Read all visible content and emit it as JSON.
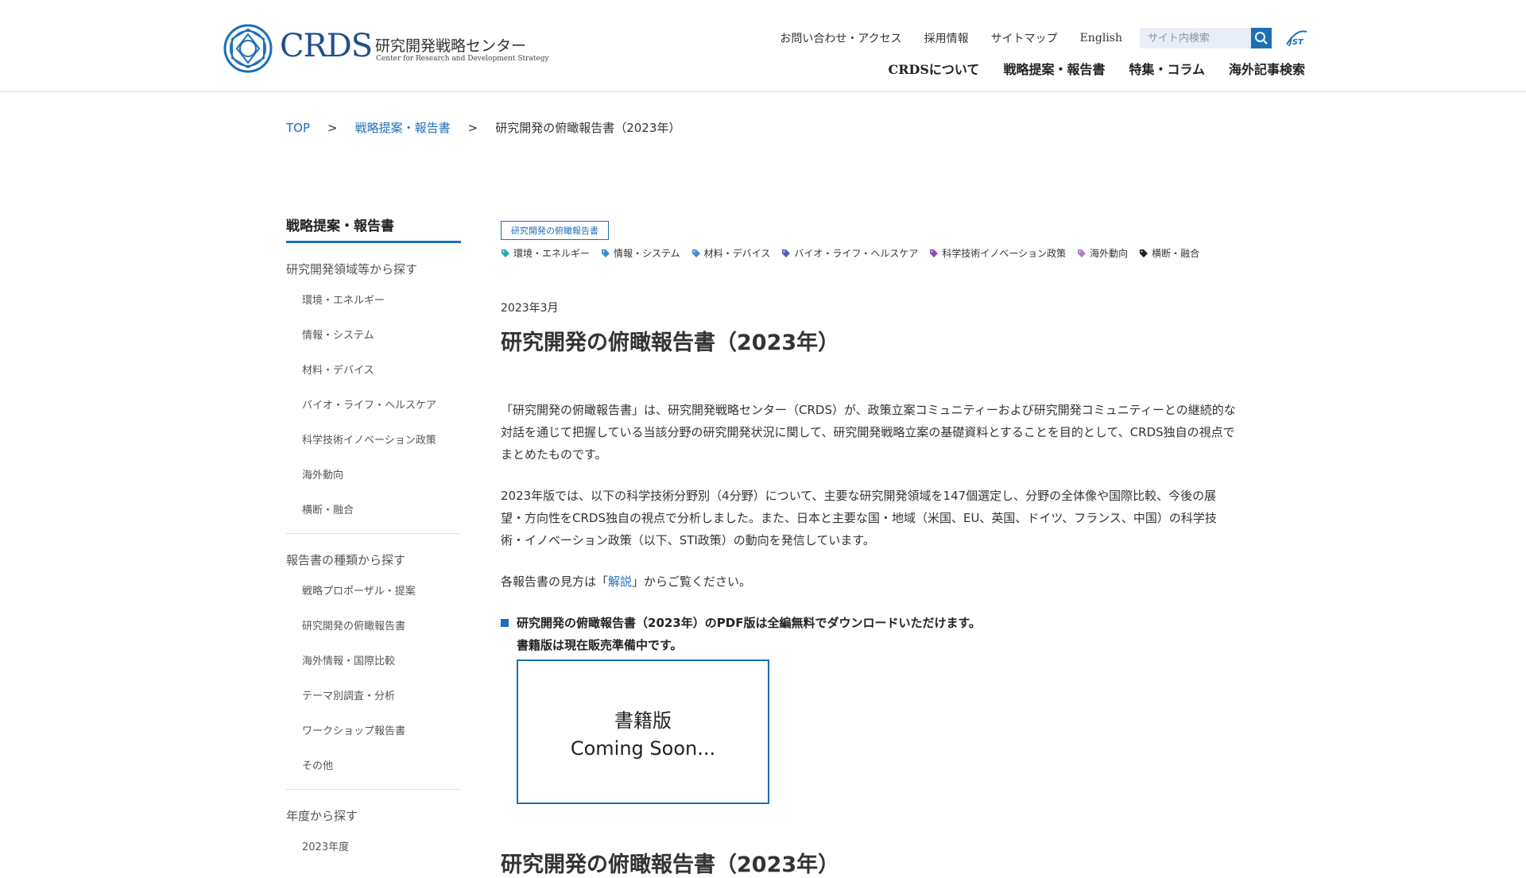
{
  "header": {
    "logo": {
      "text": "CRDS",
      "jp": "研究開発戦略センター",
      "en": "Center for Research and Development Strategy"
    },
    "util_links": [
      "お問い合わせ・アクセス",
      "採用情報",
      "サイトマップ",
      "English"
    ],
    "search": {
      "placeholder": "サイト内検索",
      "button_icon": "search-icon"
    },
    "jst_logo": "JST",
    "main_nav": [
      "CRDSについて",
      "戦略提案・報告書",
      "特集・コラム",
      "海外記事検索"
    ]
  },
  "breadcrumb": {
    "items": [
      "TOP",
      "戦略提案・報告書"
    ],
    "separator": ">",
    "current": "研究開発の俯瞰報告書（2023年）"
  },
  "sidebar": {
    "title": "戦略提案・報告書",
    "sections": [
      {
        "heading": "研究開発領域等から探す",
        "items": [
          "環境・エネルギー",
          "情報・システム",
          "材料・デバイス",
          "バイオ・ライフ・ヘルスケア",
          "科学技術イノベーション政策",
          "海外動向",
          "横断・融合"
        ]
      },
      {
        "heading": "報告書の種類から探す",
        "items": [
          "戦略プロポーザル・提案",
          "研究開発の俯瞰報告書",
          "海外情報・国際比較",
          "テーマ別調査・分析",
          "ワークショップ報告書",
          "その他"
        ]
      },
      {
        "heading": "年度から探す",
        "items": [
          "2023年度"
        ]
      }
    ]
  },
  "main": {
    "category_badge": "研究開発の俯瞰報告書",
    "tags": [
      {
        "label": "環境・エネルギー",
        "color": "#2aa7b8"
      },
      {
        "label": "情報・システム",
        "color": "#3a8fd0"
      },
      {
        "label": "材料・デバイス",
        "color": "#4a8bd6"
      },
      {
        "label": "バイオ・ライフ・ヘルスケア",
        "color": "#5a5fb0"
      },
      {
        "label": "科学技術イノベーション政策",
        "color": "#8a4fb0"
      },
      {
        "label": "海外動向",
        "color": "#b07ac8"
      },
      {
        "label": "横断・融合",
        "color": "#222222"
      }
    ],
    "date": "2023年3月",
    "title": "研究開発の俯瞰報告書（2023年）",
    "para1": "「研究開発の俯瞰報告書」は、研究開発戦略センター（CRDS）が、政策立案コミュニティーおよび研究開発コミュニティーとの継続的な対話を通じて把握している当該分野の研究開発状況に関して、研究開発戦略立案の基礎資料とすることを目的として、CRDS独自の視点でまとめたものです。",
    "para2": "2023年版では、以下の科学技術分野別（4分野）について、主要な研究開発領域を147個選定し、分野の全体像や国際比較、今後の展望・方向性をCRDS独自の視点で分析しました。また、日本と主要な国・地域（米国、EU、英国、ドイツ、フランス、中国）の科学技術・イノベーション政策（以下、STI政策）の動向を発信しています。",
    "para3_prefix": "各報告書の見方は「",
    "para3_link": "解説",
    "para3_suffix": "」からご覧ください。",
    "notice_line1": "研究開発の俯瞰報告書（2023年）のPDF版は全編無料でダウンロードいただけます。",
    "notice_line2": "書籍版は現在販売準備中です。",
    "book_line1": "書籍版",
    "book_line2": "Coming Soon...",
    "section_title": "研究開発の俯瞰報告書（2023年）"
  }
}
